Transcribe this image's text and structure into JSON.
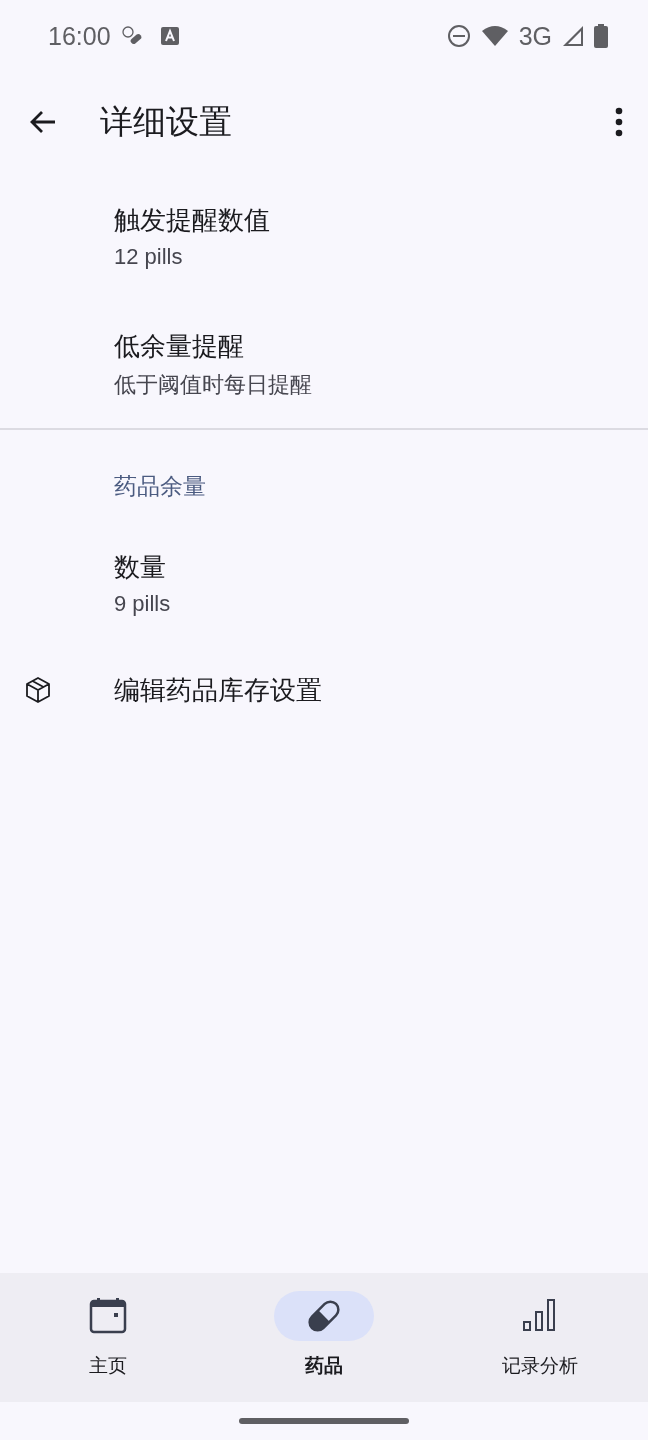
{
  "status_bar": {
    "time": "16:00",
    "network": "3G"
  },
  "app_bar": {
    "title": "详细设置"
  },
  "settings": [
    {
      "kind": "item",
      "title": "触发提醒数值",
      "summary": "12 pills"
    },
    {
      "kind": "item",
      "title": "低余量提醒",
      "summary": "低于阈值时每日提醒"
    },
    {
      "kind": "divider"
    },
    {
      "kind": "header",
      "title": "药品余量"
    },
    {
      "kind": "item",
      "title": "数量",
      "summary": "9 pills"
    },
    {
      "kind": "action",
      "title": "编辑药品库存设置"
    }
  ],
  "nav": [
    {
      "label": "主页",
      "selected": false
    },
    {
      "label": "药品",
      "selected": true
    },
    {
      "label": "记录分析",
      "selected": false
    }
  ]
}
